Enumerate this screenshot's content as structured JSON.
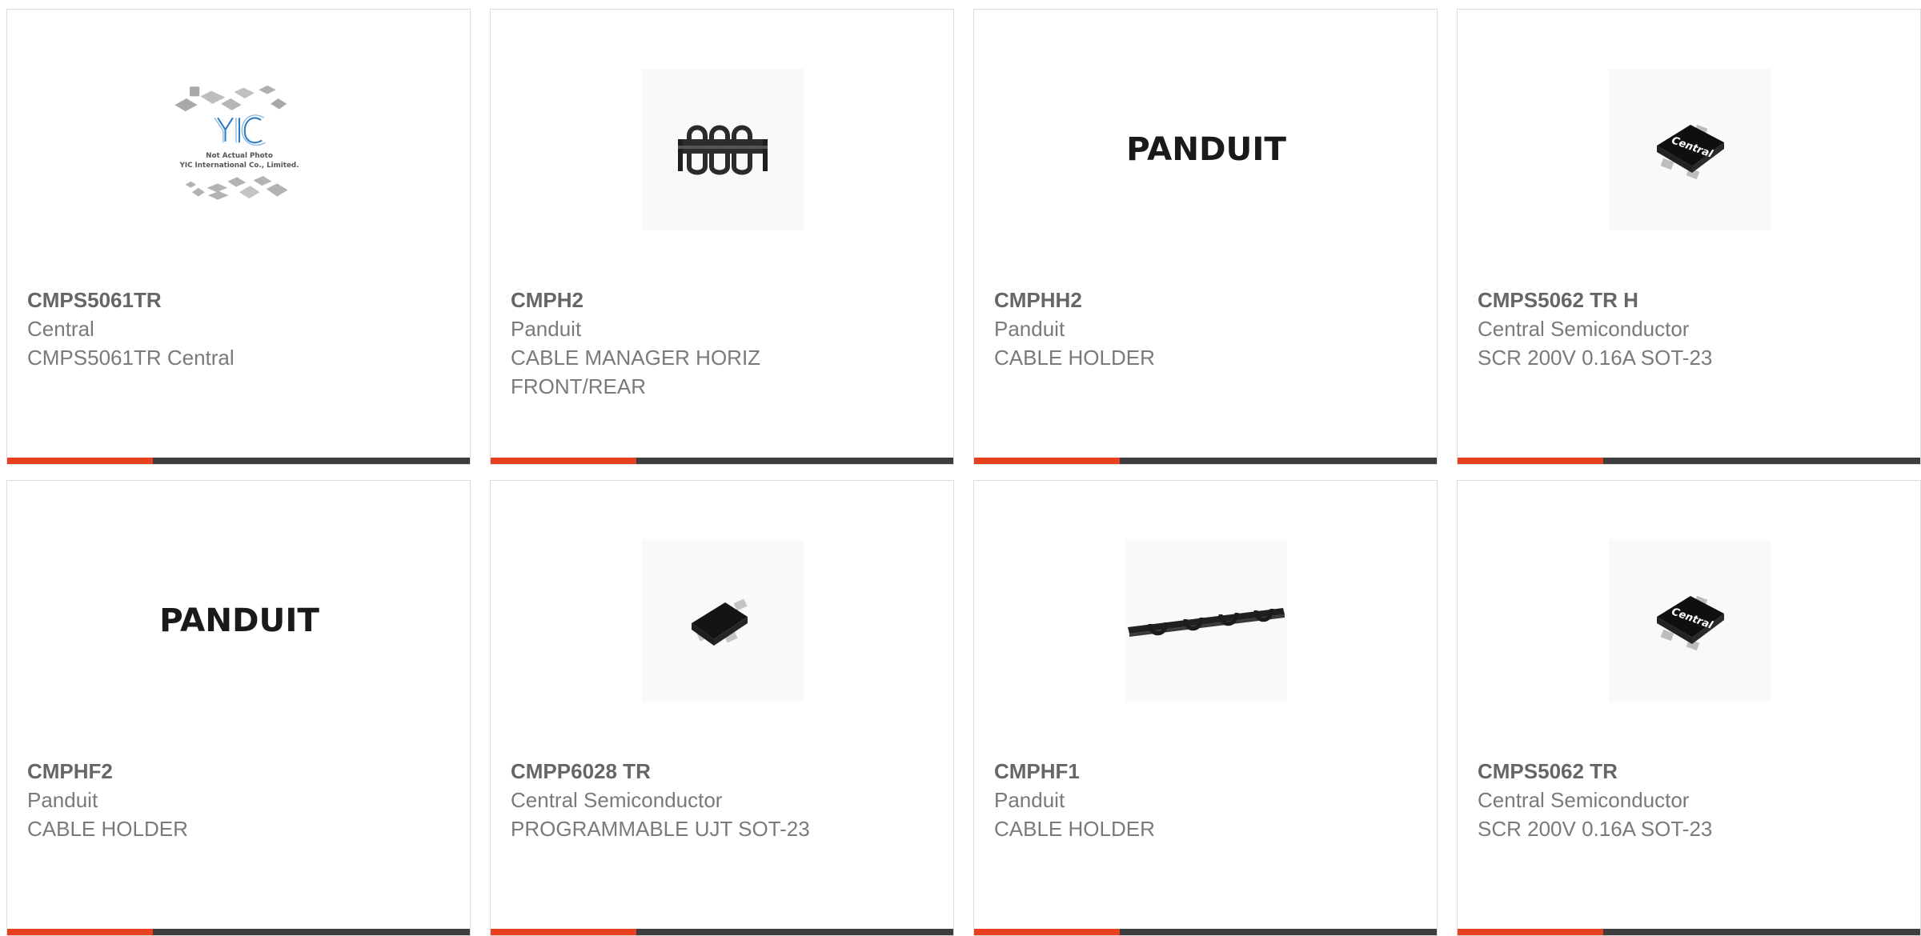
{
  "colors": {
    "accent": "#e8401c",
    "bar_dark": "#3d3d3d",
    "border": "#dcdcdc",
    "text": "#666666"
  },
  "products": [
    {
      "part_number": "CMPS5061TR",
      "manufacturer": "Central",
      "description": "CMPS5061TR Central",
      "image": "yic-placeholder",
      "image_text_1": "Not Actual Photo",
      "image_text_2": "YIC International Co., Limited.",
      "image_logo": "YIC"
    },
    {
      "part_number": "CMPH2",
      "manufacturer": "Panduit",
      "description": "CABLE MANAGER HORIZ FRONT/REAR",
      "image": "cable-manager-photo"
    },
    {
      "part_number": "CMPHH2",
      "manufacturer": "Panduit",
      "description": "CABLE HOLDER",
      "image": "panduit-logo",
      "logo_text": "PANDUIT"
    },
    {
      "part_number": "CMPS5062 TR H",
      "manufacturer": "Central Semiconductor",
      "description": "SCR 200V 0.16A SOT-23",
      "image": "sot23-central-chip",
      "chip_text": "Central"
    },
    {
      "part_number": "CMPHF2",
      "manufacturer": "Panduit",
      "description": "CABLE HOLDER",
      "image": "panduit-logo",
      "logo_text": "PANDUIT"
    },
    {
      "part_number": "CMPP6028 TR",
      "manufacturer": "Central Semiconductor",
      "description": "PROGRAMMABLE UJT SOT-23",
      "image": "sot23-chip"
    },
    {
      "part_number": "CMPHF1",
      "manufacturer": "Panduit",
      "description": "CABLE HOLDER",
      "image": "cable-holder-rail-photo"
    },
    {
      "part_number": "CMPS5062 TR",
      "manufacturer": "Central Semiconductor",
      "description": "SCR 200V 0.16A SOT-23",
      "image": "sot23-central-chip",
      "chip_text": "Central"
    }
  ]
}
